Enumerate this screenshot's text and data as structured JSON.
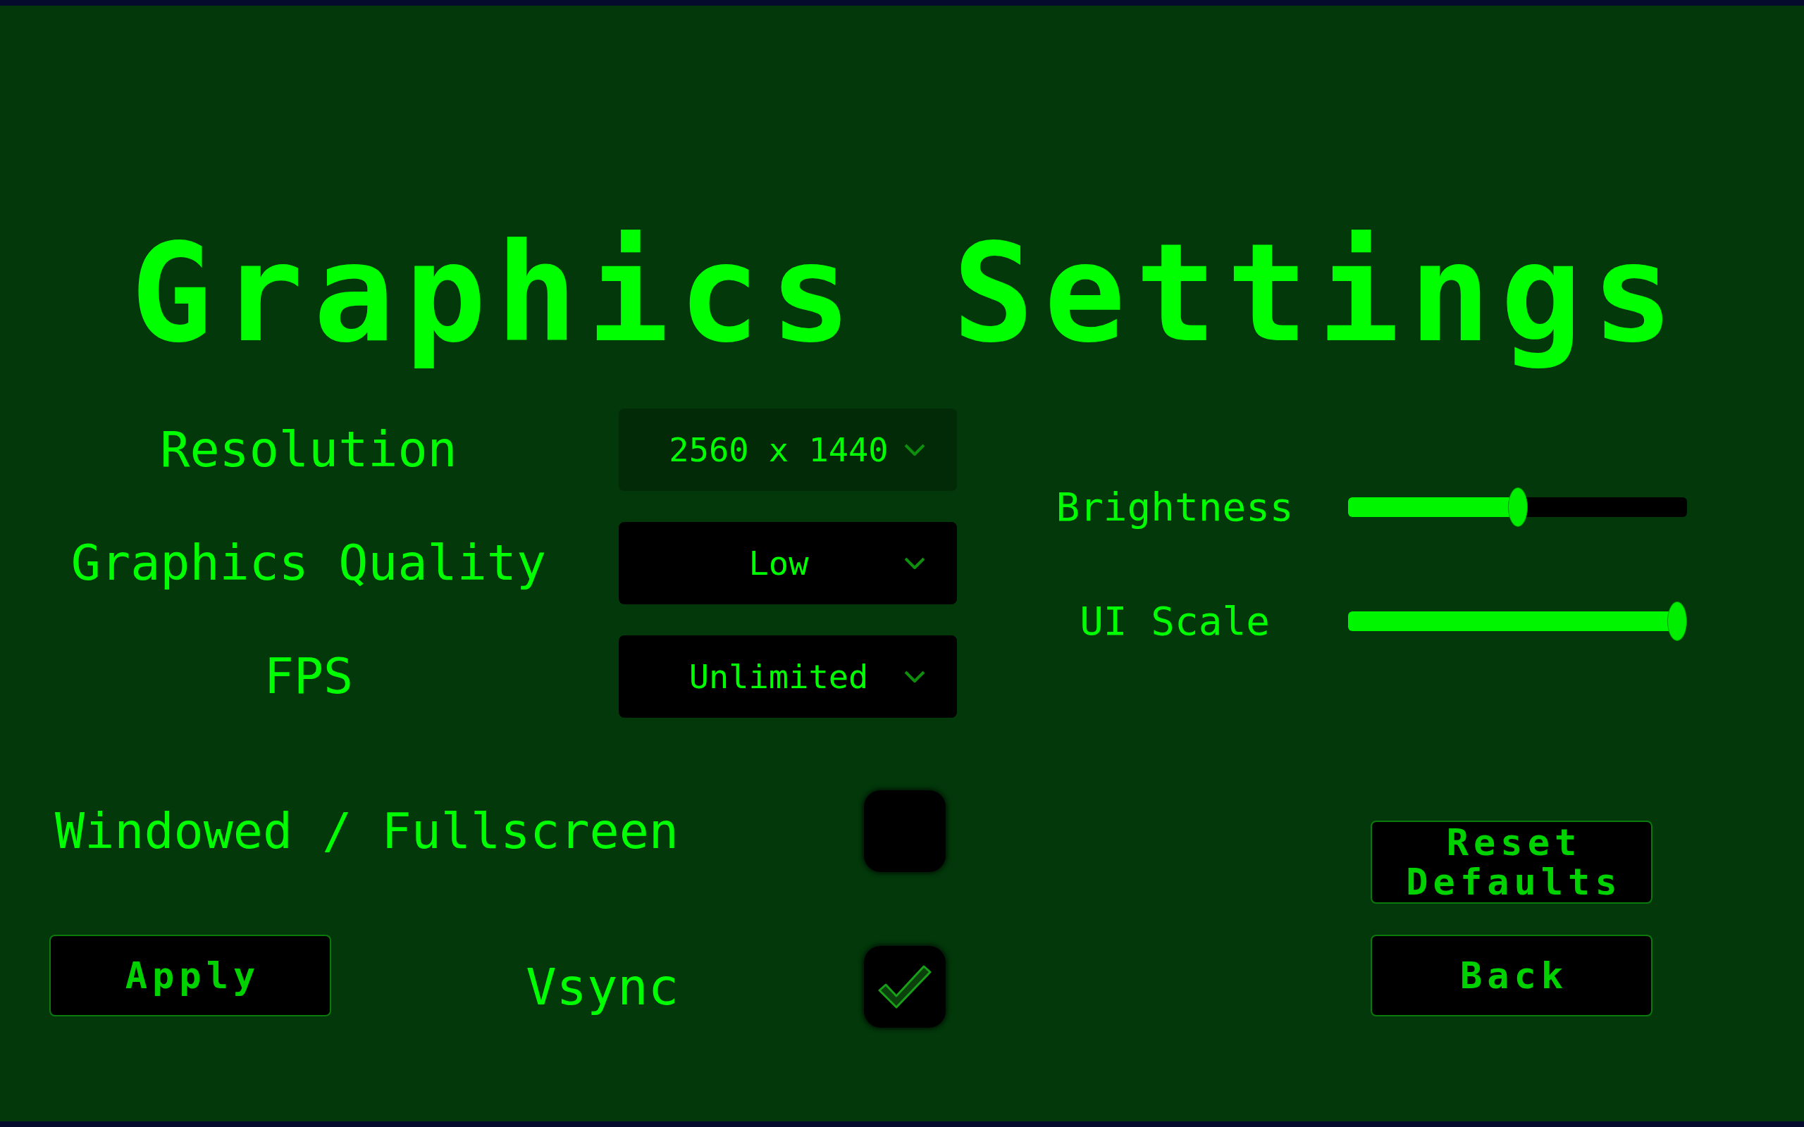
{
  "title": "Graphics Settings",
  "dropdowns": [
    {
      "label": "Resolution",
      "value": "2560 x 1440",
      "highlighted": true
    },
    {
      "label": "Graphics Quality",
      "value": "Low",
      "highlighted": false
    },
    {
      "label": "FPS",
      "value": "Unlimited",
      "highlighted": false
    }
  ],
  "toggles": [
    {
      "label": "Windowed / Fullscreen",
      "checked": false
    },
    {
      "label": "Vsync",
      "checked": true
    }
  ],
  "apply_button": {
    "label": "Apply"
  },
  "sliders": [
    {
      "label": "Brightness",
      "level": 0.5
    },
    {
      "label": "UI Scale",
      "level": 1
    }
  ],
  "buttons": [
    {
      "label": "Reset Defaults"
    },
    {
      "label": "Back"
    }
  ]
}
